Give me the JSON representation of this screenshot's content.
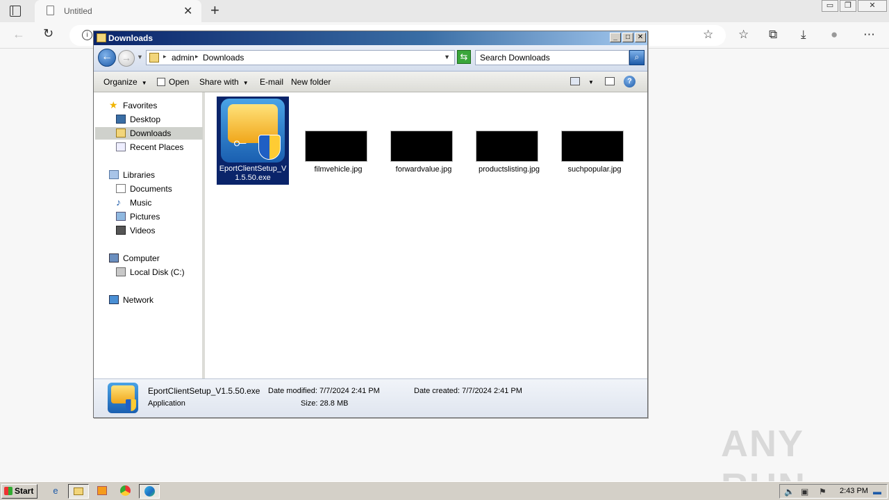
{
  "browser": {
    "tab_title": "Untitled",
    "tab_close": "✕",
    "new_tab": "+",
    "window_controls": [
      "▭",
      "❐",
      "✕"
    ]
  },
  "explorer": {
    "title": "Downloads",
    "title_buttons": [
      "_",
      "□",
      "✕"
    ],
    "path": [
      "admin",
      "Downloads"
    ],
    "search_placeholder": "Search Downloads",
    "commands": {
      "organize": "Organize",
      "open": "Open",
      "share_with": "Share with",
      "email": "E-mail",
      "new_folder": "New folder"
    },
    "nav": {
      "favorites": "Favorites",
      "desktop": "Desktop",
      "downloads": "Downloads",
      "recent_places": "Recent Places",
      "libraries": "Libraries",
      "documents": "Documents",
      "music": "Music",
      "pictures": "Pictures",
      "videos": "Videos",
      "computer": "Computer",
      "local_disk": "Local Disk (C:)",
      "network": "Network"
    },
    "files": [
      {
        "name_line1": "EportClientSetup_V",
        "name_line2": "1.5.50.exe",
        "selected": true
      },
      {
        "name": "filmvehicle.jpg"
      },
      {
        "name": "forwardvalue.jpg"
      },
      {
        "name": "productslisting.jpg"
      },
      {
        "name": "suchpopular.jpg"
      }
    ],
    "details": {
      "name": "EportClientSetup_V1.5.50.exe",
      "type": "Application",
      "date_modified": "Date modified: 7/7/2024 2:41 PM",
      "size": "Size: 28.8 MB",
      "date_created": "Date created: 7/7/2024 2:41 PM"
    }
  },
  "watermark": "ANY RUN",
  "taskbar": {
    "start": "Start",
    "clock": "2:43 PM"
  },
  "colors": {
    "title_gradient_start": "#0a246a",
    "selection": "#0a246a",
    "taskbar": "#d4d0c8"
  }
}
